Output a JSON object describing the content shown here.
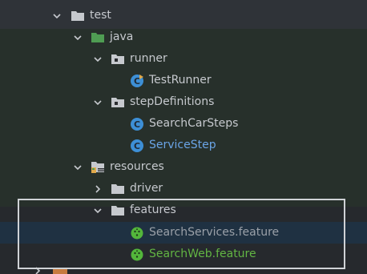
{
  "tree": {
    "test": {
      "label": "test"
    },
    "java": {
      "label": "java"
    },
    "runner": {
      "label": "runner"
    },
    "test_runner": {
      "label": "TestRunner"
    },
    "step_definitions": {
      "label": "stepDefinitions"
    },
    "search_car_steps": {
      "label": "SearchCarSteps"
    },
    "service_step": {
      "label": "ServiceStep"
    },
    "resources": {
      "label": "resources"
    },
    "driver": {
      "label": "driver"
    },
    "features": {
      "label": "features"
    },
    "search_services_feature": {
      "label": "SearchServices.feature"
    },
    "search_web_feature": {
      "label": "SearchWeb.feature"
    }
  },
  "colors": {
    "folder_gray": "#c6c9ce",
    "folder_green": "#4f9d53",
    "class_blue": "#3d8fd6",
    "cucumber_green": "#53b63b",
    "selected_row": "#1f3142"
  }
}
